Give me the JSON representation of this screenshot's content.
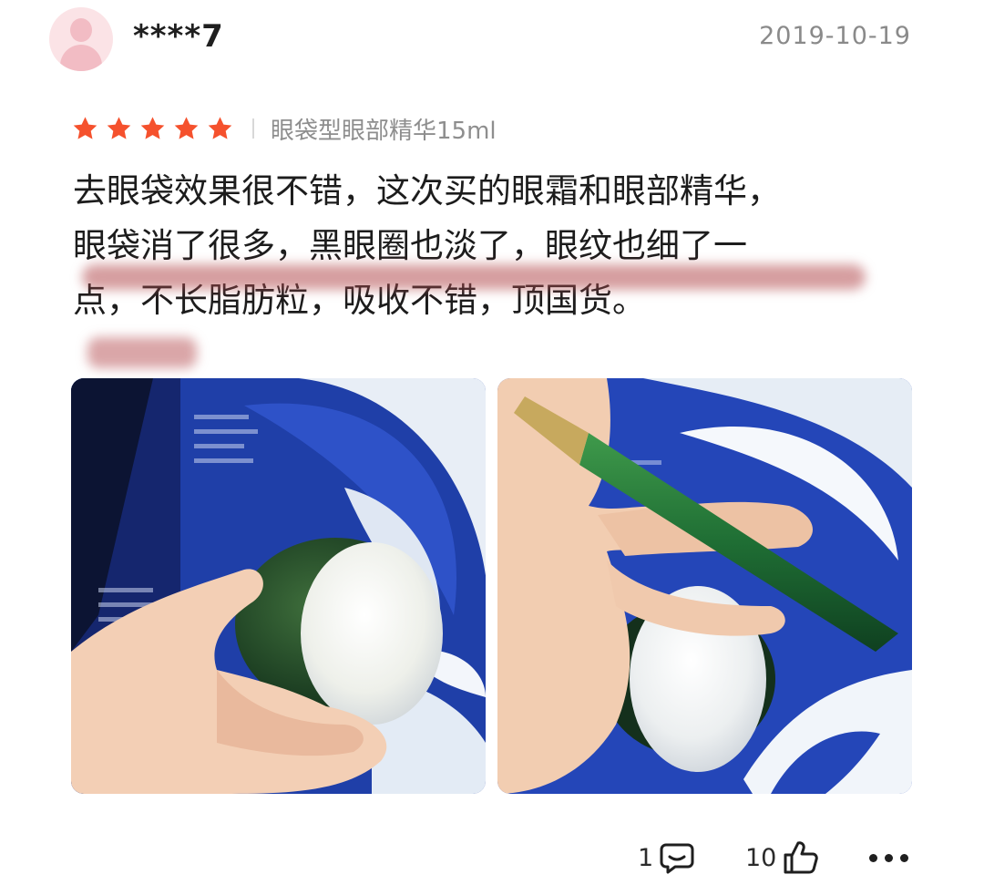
{
  "user": {
    "name": "****7",
    "date": "2019-10-19"
  },
  "rating": {
    "stars": 5,
    "max": 5,
    "color": "#f5512d"
  },
  "variant": "眼袋型眼部精华15ml",
  "review": {
    "line1": "去眼袋效果很不错，这次买的眼霜和眼部精华，",
    "line2": "眼袋消了很多，黑眼圈也淡了，眼纹也细了一",
    "line3": "点，不长脂肪粒，吸收不错，顶国货。"
  },
  "photos": [
    {
      "name": "jar-in-hand-photo"
    },
    {
      "name": "jar-and-tube-photo"
    }
  ],
  "actions": {
    "comment_count": "1",
    "like_count": "10",
    "comment_icon": "comment-icon",
    "like_icon": "thumbs-up-icon",
    "more_icon": "more-icon"
  }
}
